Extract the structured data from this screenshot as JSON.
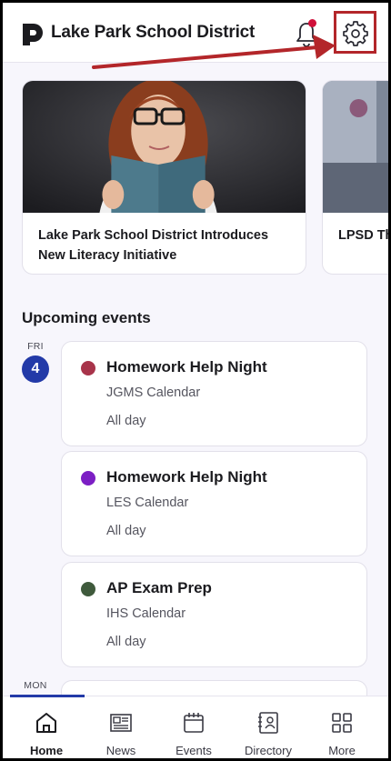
{
  "header": {
    "title": "Lake Park School District",
    "notification_icon": "bell-icon",
    "settings_icon": "gear-icon",
    "notification_badge_color": "#d0103a",
    "annotation_color": "#b3262a"
  },
  "news": [
    {
      "title": "Lake Park School District Introduces New Literacy Initiative"
    },
    {
      "title": "LPSD Th"
    }
  ],
  "events": {
    "section_title": "Upcoming events",
    "days": [
      {
        "weekday": "FRI",
        "day": "4",
        "items": [
          {
            "title": "Homework Help Night",
            "calendar": "JGMS Calendar",
            "time": "All day",
            "color": "#a8344a"
          },
          {
            "title": "Homework Help Night",
            "calendar": "LES Calendar",
            "time": "All day",
            "color": "#7c1fc4"
          },
          {
            "title": "AP Exam Prep",
            "calendar": "IHS Calendar",
            "time": "All day",
            "color": "#3f5a3c"
          }
        ]
      },
      {
        "weekday": "MON"
      }
    ]
  },
  "nav": {
    "items": [
      {
        "label": "Home",
        "icon": "home-icon"
      },
      {
        "label": "News",
        "icon": "newspaper-icon"
      },
      {
        "label": "Events",
        "icon": "calendar-icon"
      },
      {
        "label": "Directory",
        "icon": "directory-icon"
      },
      {
        "label": "More",
        "icon": "grid-icon"
      }
    ],
    "active": "Home",
    "accent": "#233aa8"
  }
}
